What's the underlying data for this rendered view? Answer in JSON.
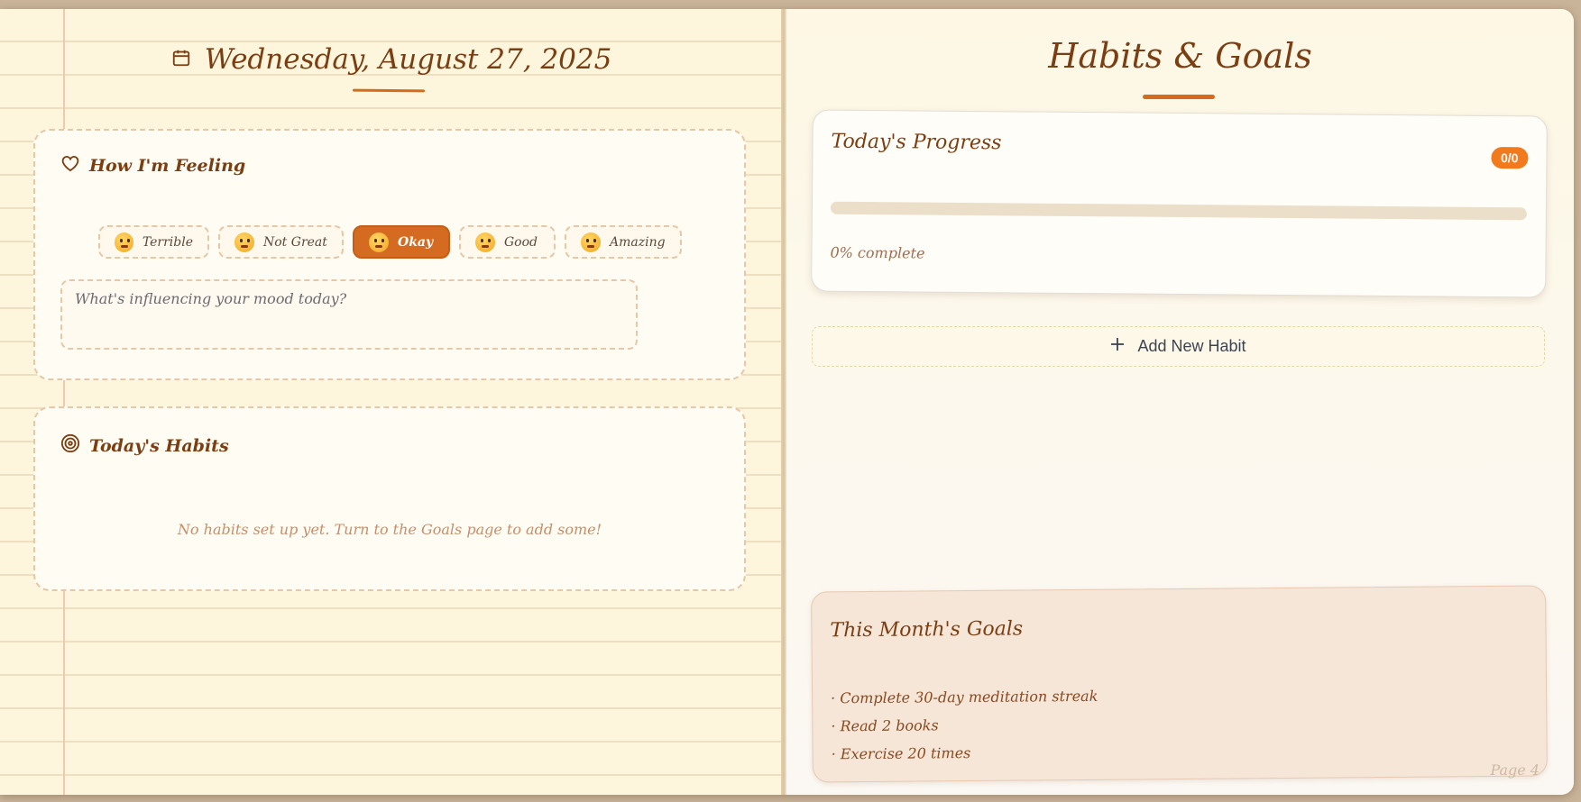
{
  "journal": {
    "date": "Wednesday, August 27, 2025"
  },
  "feeling": {
    "title": "How I'm Feeling",
    "moods": [
      {
        "label": "Terrible",
        "selected": false
      },
      {
        "label": "Not Great",
        "selected": false
      },
      {
        "label": "Okay",
        "selected": true
      },
      {
        "label": "Good",
        "selected": false
      },
      {
        "label": "Amazing",
        "selected": false
      }
    ],
    "note_placeholder": "What's influencing your mood today?"
  },
  "habits_today": {
    "title": "Today's Habits",
    "empty_message": "No habits set up yet. Turn to the Goals page to add some!"
  },
  "goals_page": {
    "title": "Habits & Goals",
    "progress": {
      "title": "Today's Progress",
      "badge": "0/0",
      "percent_text": "0% complete",
      "fraction": 0
    },
    "add_habit_label": "Add New Habit",
    "month_goals": {
      "title": "This Month's Goals",
      "items": [
        "Complete 30-day meditation streak",
        "Read 2 books",
        "Exercise 20 times"
      ]
    },
    "page_label": "Page 4"
  },
  "colors": {
    "accent": "#d46b21",
    "badge": "#f17a1f",
    "ink": "#7a3e12"
  }
}
